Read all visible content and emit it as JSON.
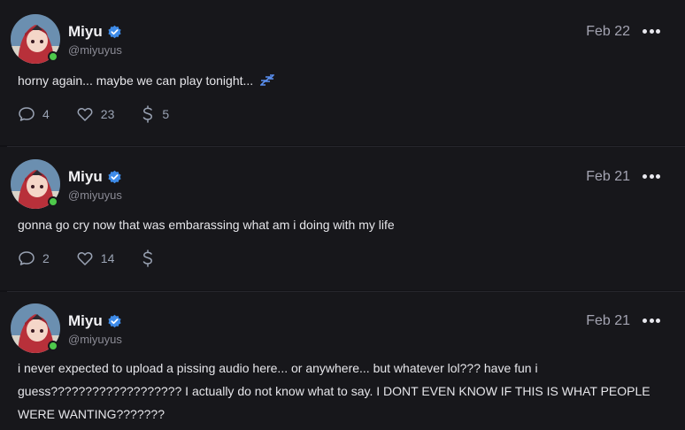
{
  "accent_color": "#3e8be8",
  "online_color": "#4ec94b",
  "posts": [
    {
      "name": "Miyu",
      "handle": "@miyuyus",
      "date": "Feb 22",
      "text": "horny again... maybe we can play tonight...",
      "emoji_icon": "sleeping-zzz-icon",
      "comments": "4",
      "likes": "23",
      "tips": "5"
    },
    {
      "name": "Miyu",
      "handle": "@miyuyus",
      "date": "Feb 21",
      "text": "gonna go cry now that was embarassing what am i doing with my life",
      "comments": "2",
      "likes": "14",
      "tips": ""
    },
    {
      "name": "Miyu",
      "handle": "@miyuyus",
      "date": "Feb 21",
      "text_lines": [
        "i never expected to upload a pissing audio here... or anywhere... but whatever lol??? have fun i",
        "guess??????????????????? I actually do not know what to say. I DONT EVEN KNOW IF THIS IS WHAT PEOPLE",
        "WERE WANTING???????"
      ]
    }
  ]
}
